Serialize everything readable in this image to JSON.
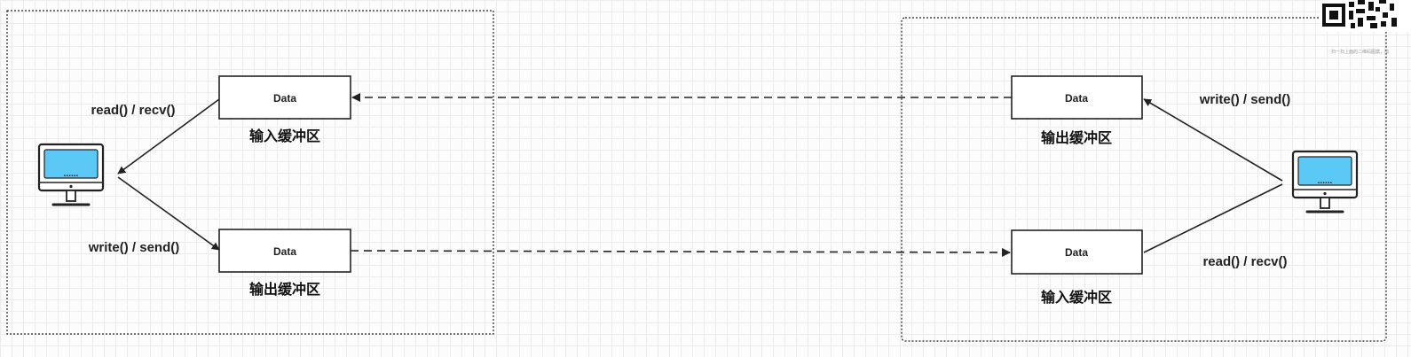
{
  "left_host": {
    "input_buffer": {
      "box_text": "Data",
      "caption": "输入缓冲区"
    },
    "output_buffer": {
      "box_text": "Data",
      "caption": "输出缓冲区"
    },
    "read_label": "read() / recv()",
    "write_label": "write() / send()",
    "screen_dots": "......"
  },
  "right_host": {
    "output_buffer": {
      "box_text": "Data",
      "caption": "输出缓冲区"
    },
    "input_buffer": {
      "box_text": "Data",
      "caption": "输入缓冲区"
    },
    "write_label": "write() / send()",
    "read_label": "read() / recv()",
    "screen_dots": "......"
  },
  "qr": {
    "icon": "qr-code-icon",
    "caption": "扫一扫上面的二维码图案，加"
  },
  "colors": {
    "screen_fill": "#5bc8f5",
    "stroke": "#222222",
    "box_fill": "#ffffff"
  }
}
